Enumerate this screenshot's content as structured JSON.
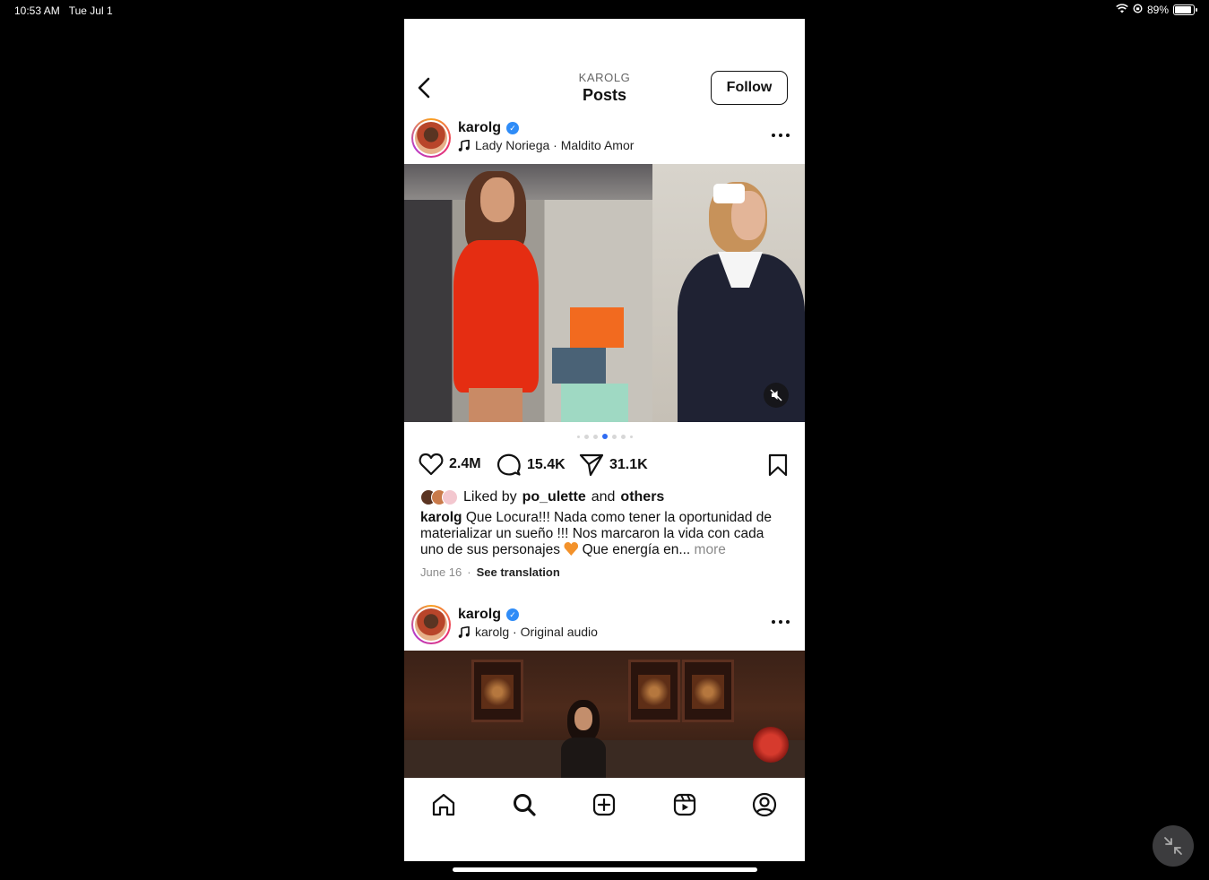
{
  "status_bar": {
    "time": "10:53 AM",
    "date": "Tue Jul 1",
    "battery": "89%",
    "battery_level": 0.89
  },
  "header": {
    "subtitle": "KAROLG",
    "title": "Posts",
    "follow_label": "Follow"
  },
  "posts": [
    {
      "username": "karolg",
      "audio": "Lady Noriega · Maldito Amor",
      "likes": "2.4M",
      "comments": "15.4K",
      "shares": "31.1K",
      "liked_by_prefix": "Liked by",
      "liked_by_user": "po_ulette",
      "liked_by_and": "and",
      "liked_by_others": "others",
      "caption_user": "karolg",
      "caption_text_1": "Que Locura!!! Nada como tener la oportunidad de materializar un sueño !!! Nos marcaron la vida con cada uno de sus personajes",
      "caption_text_2": "Que energía en...",
      "caption_more": "more",
      "date": "June 16",
      "separator": "·",
      "see_translation": "See translation",
      "carousel_active_index": 3
    },
    {
      "username": "karolg",
      "audio": "karolg · Original audio"
    }
  ],
  "tab_bar": [
    "home-icon",
    "search-icon",
    "create-icon",
    "reels-icon",
    "profile-icon"
  ],
  "colors": {
    "verified": "#2f8cf7",
    "carousel_active": "#2f6cf3",
    "caption_emoji": "#f3922b"
  }
}
